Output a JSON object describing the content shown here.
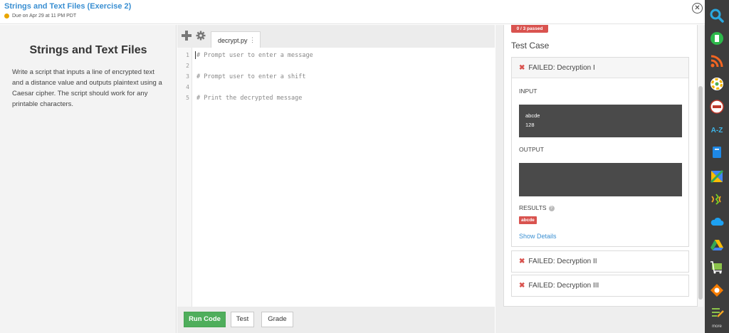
{
  "header": {
    "title": "Strings and Text Files (Exercise 2)",
    "due": "Due on Apr 29 at 11 PM PDT",
    "close_glyph": "✕"
  },
  "description": {
    "title": "Strings and Text Files",
    "text": "Write a script that inputs a line of encrypted text and a distance value and outputs plaintext using a Caesar cipher. The script should work for any printable characters."
  },
  "editor": {
    "tab_name": "decrypt.py",
    "tab_menu_glyph": "⋮",
    "lines": [
      {
        "num": "1",
        "text": "# Prompt user to enter a message"
      },
      {
        "num": "2",
        "text": ""
      },
      {
        "num": "3",
        "text": "# Prompt user to enter a shift"
      },
      {
        "num": "4",
        "text": ""
      },
      {
        "num": "5",
        "text": "# Print the decrypted message"
      }
    ],
    "buttons": {
      "run": "Run Code",
      "test": "Test",
      "grade": "Grade"
    }
  },
  "results": {
    "passed_badge": "0 / 3 passed",
    "heading": "Test Case",
    "cases": [
      {
        "status_glyph": "✖",
        "title": "FAILED: Decryption I",
        "input_label": "INPUT",
        "input_lines": [
          "abcde",
          "128"
        ],
        "output_label": "OUTPUT",
        "results_label": "RESULTS",
        "results_tag": "abcde",
        "show_details": "Show Details"
      },
      {
        "status_glyph": "✖",
        "title": "FAILED: Decryption II"
      },
      {
        "status_glyph": "✖",
        "title": "FAILED: Decryption III"
      }
    ]
  },
  "dock": {
    "more_label": "more",
    "icons": [
      "search-icon",
      "evernote-icon",
      "rss-icon",
      "color-wheel-icon",
      "stamp-icon",
      "a-z-icon",
      "book-icon",
      "maps-icon",
      "voice-icon",
      "cloud-icon",
      "drive-icon",
      "cart-icon",
      "gear-badge-icon",
      "checklist-icon"
    ],
    "az_text": "A-Z"
  },
  "colors": {
    "accent_blue": "#3a8fd2",
    "run_green": "#4fae5c",
    "fail_red": "#d9534f",
    "dock_bg": "#3d3d3d"
  }
}
